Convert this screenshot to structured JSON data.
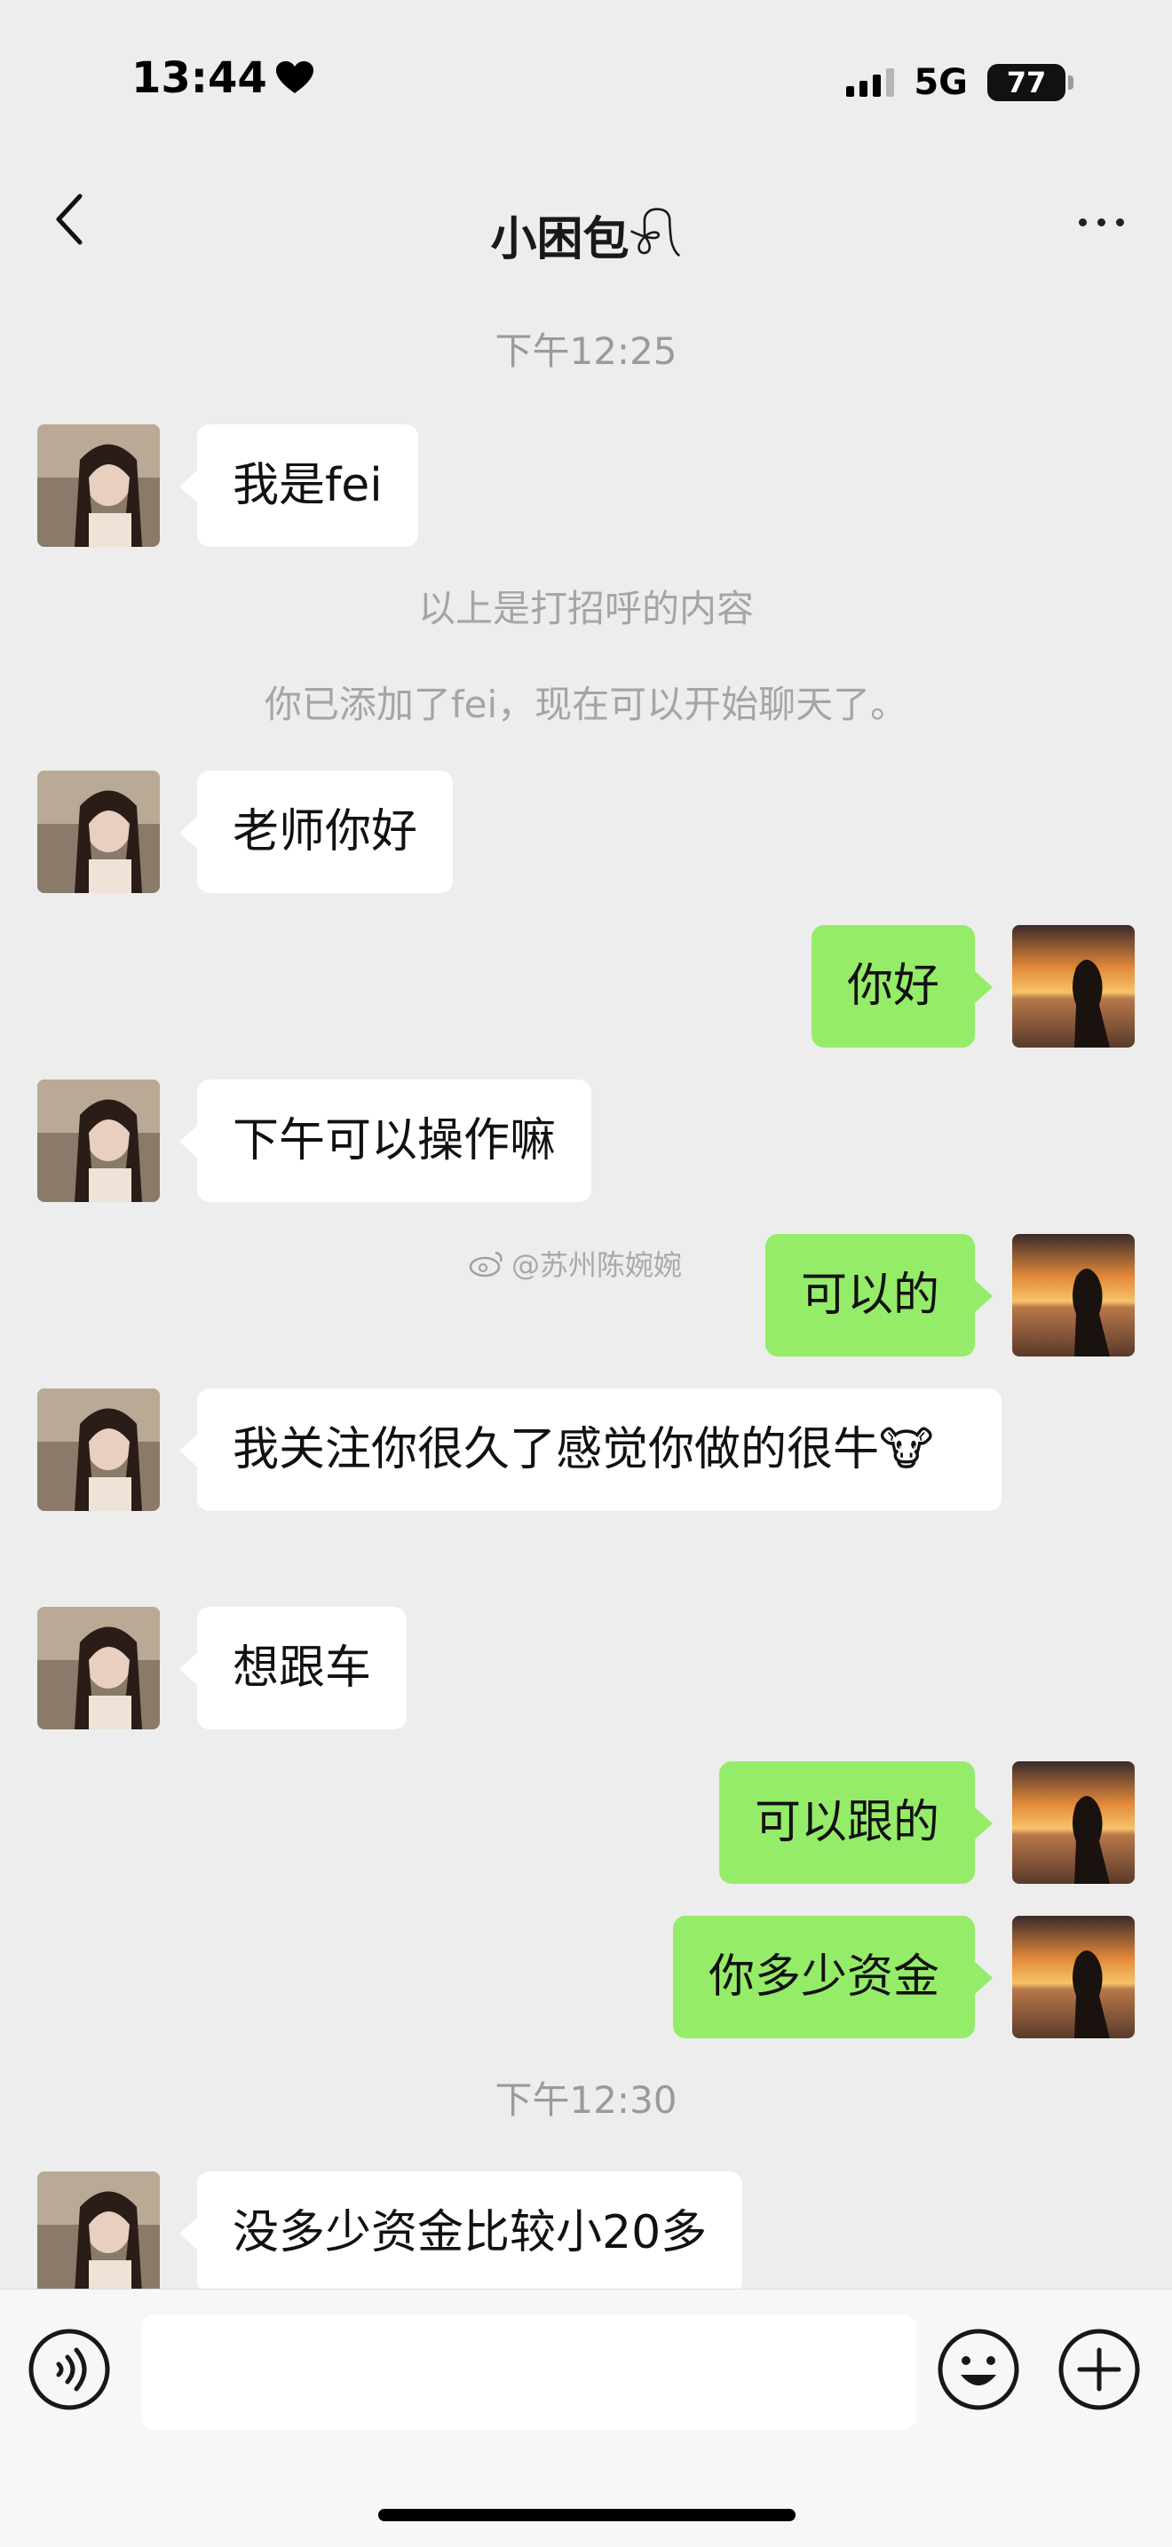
{
  "status_bar": {
    "time": "13:44",
    "heart_icon": "heart-icon",
    "network": "5G",
    "battery": "77"
  },
  "nav": {
    "title": "小困包𓍯",
    "back_icon": "chevron-left-icon",
    "more_icon": "more-dots-icon"
  },
  "chat": {
    "timestamps": [
      "下午12:25",
      "下午12:30"
    ],
    "system_messages": [
      "以上是打招呼的内容",
      "你已添加了fei，现在可以开始聊天了。"
    ],
    "messages": [
      {
        "side": "left",
        "text": "我是fei"
      },
      {
        "side": "left",
        "text": "老师你好"
      },
      {
        "side": "right",
        "text": "你好"
      },
      {
        "side": "left",
        "text": "下午可以操作嘛"
      },
      {
        "side": "right",
        "text": "可以的"
      },
      {
        "side": "left",
        "text": "我关注你很久了感觉你做的很牛🐮"
      },
      {
        "side": "left",
        "text": "想跟车"
      },
      {
        "side": "right",
        "text": "可以跟的"
      },
      {
        "side": "right",
        "text": "你多少资金"
      },
      {
        "side": "left",
        "text": "没多少资金比较小20多"
      }
    ],
    "watermark": "@苏州陈婉婉"
  },
  "input_bar": {
    "voice_icon": "voice-icon",
    "input_value": "",
    "emoji_icon": "emoji-icon",
    "plus_icon": "plus-icon"
  },
  "colors": {
    "background": "#ededed",
    "bubble_self": "#95ec69",
    "bubble_other": "#ffffff"
  }
}
